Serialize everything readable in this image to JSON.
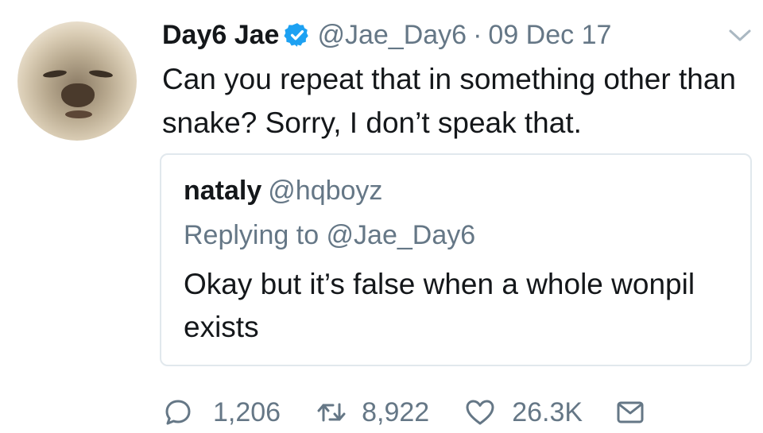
{
  "author": {
    "name": "Day6 Jae",
    "handle": "@Jae_Day6",
    "separator": "·",
    "date": "09 Dec 17",
    "verified": true,
    "avatar_icon": "dog-avatar"
  },
  "tweet": {
    "text": "Can you repeat that in something other than snake? Sorry, I don’t speak that."
  },
  "quoted_tweet": {
    "name": "nataly",
    "handle": "@hqboyz",
    "replying_to": "Replying to @Jae_Day6",
    "text": "Okay but it’s false when a whole wonpil exists"
  },
  "actions": {
    "replies": "1,206",
    "retweets": "8,922",
    "likes": "26.3K",
    "icons": [
      "reply-icon",
      "retweet-icon",
      "heart-icon",
      "message-icon"
    ]
  },
  "colors": {
    "text": "#14171a",
    "muted": "#657786",
    "verified": "#1da1f2",
    "border": "#e1e8ed"
  }
}
